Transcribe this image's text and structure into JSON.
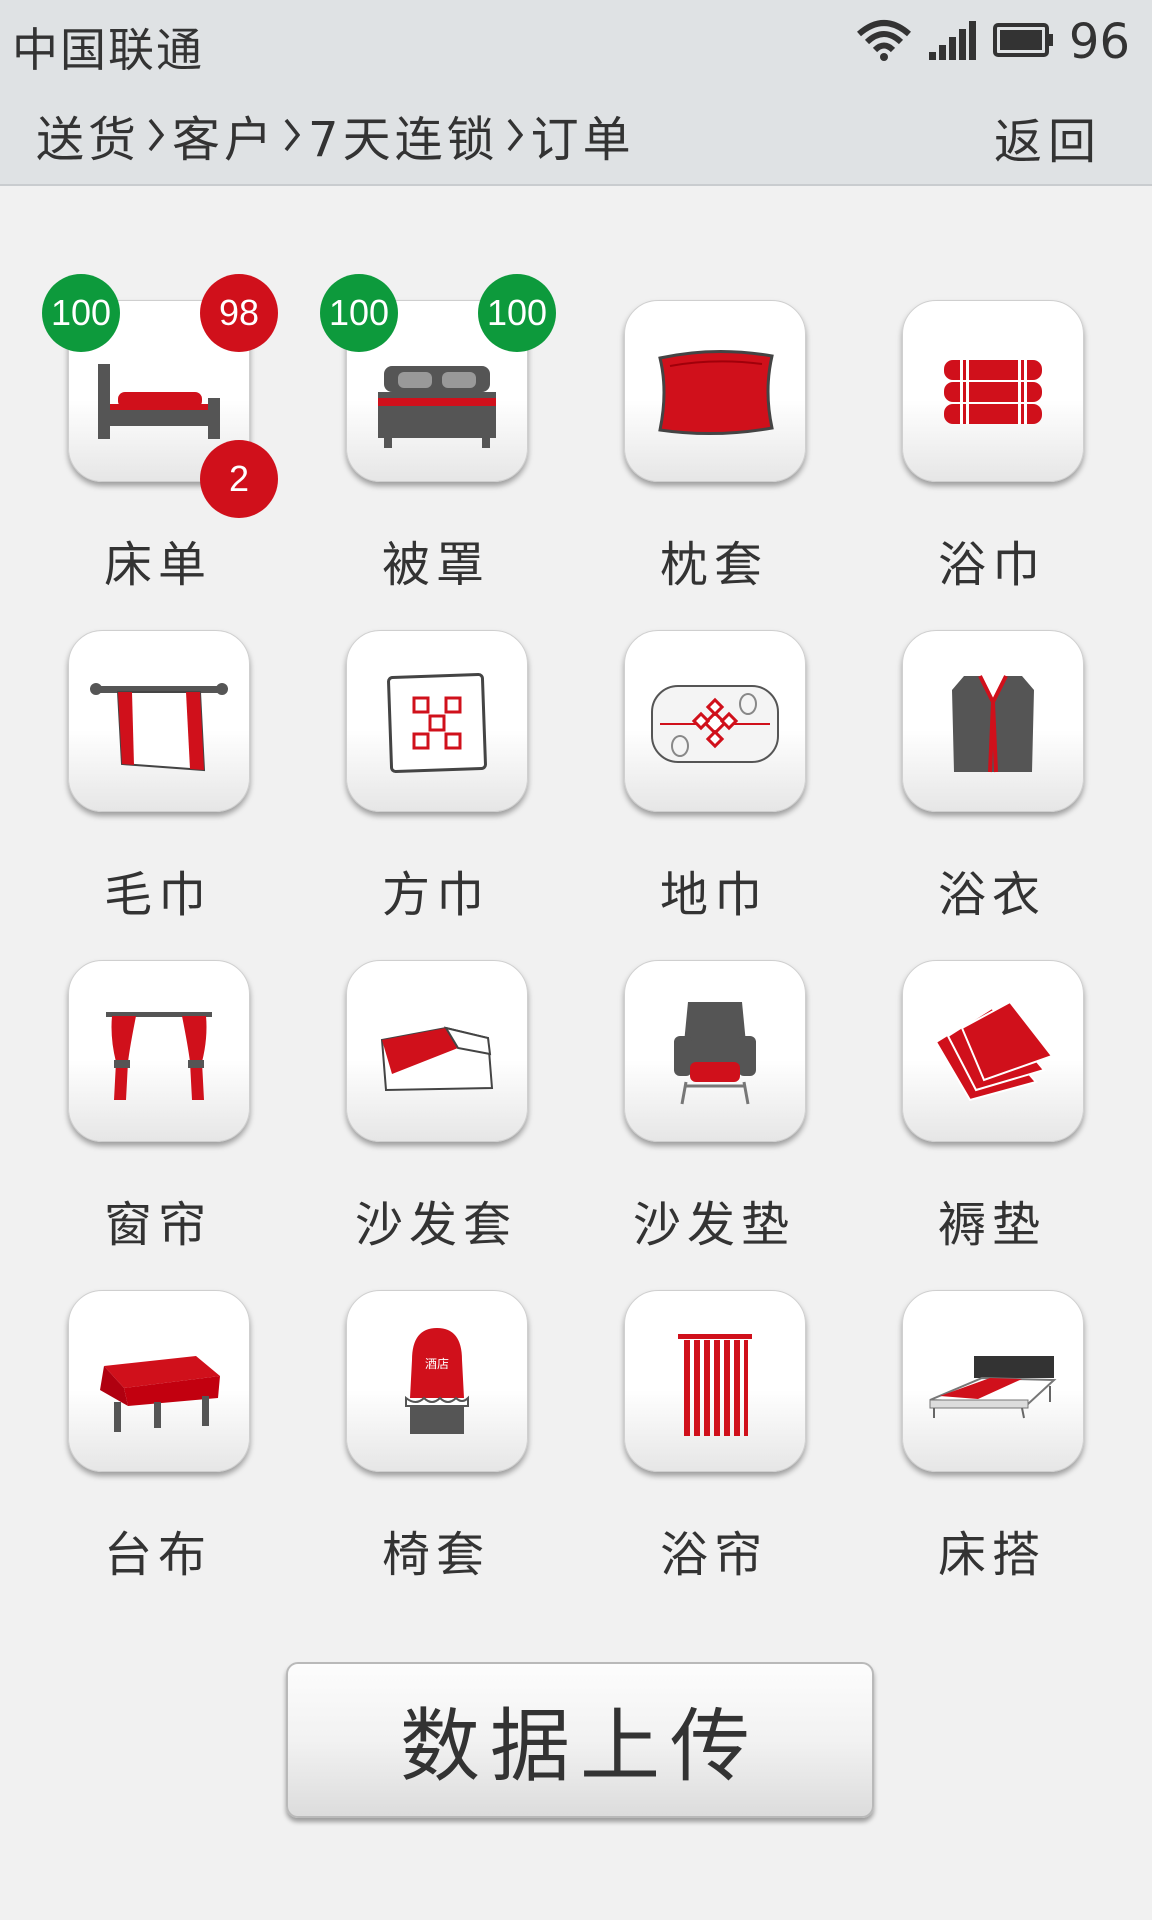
{
  "status_bar": {
    "carrier": "中国联通",
    "battery_percent": "96",
    "icons": [
      "wifi-icon",
      "signal-icon",
      "battery-icon"
    ]
  },
  "nav": {
    "breadcrumb": [
      "送货",
      "客户",
      "7天连锁",
      "订单"
    ],
    "back_label": "返回"
  },
  "items": [
    {
      "label": "床单",
      "icon": "bed-sheet-icon",
      "badges": {
        "top_left": "100",
        "top_right": "98",
        "bottom_right": "2"
      }
    },
    {
      "label": "被罩",
      "icon": "duvet-cover-icon",
      "badges": {
        "top_left": "100",
        "top_right": "100"
      }
    },
    {
      "label": "枕套",
      "icon": "pillowcase-icon"
    },
    {
      "label": "浴巾",
      "icon": "bath-towel-icon"
    },
    {
      "label": "毛巾",
      "icon": "towel-icon"
    },
    {
      "label": "方巾",
      "icon": "square-towel-icon"
    },
    {
      "label": "地巾",
      "icon": "floor-mat-icon"
    },
    {
      "label": "浴衣",
      "icon": "bathrobe-icon"
    },
    {
      "label": "窗帘",
      "icon": "curtain-icon"
    },
    {
      "label": "沙发套",
      "icon": "sofa-cover-icon"
    },
    {
      "label": "沙发垫",
      "icon": "sofa-cushion-icon"
    },
    {
      "label": "褥垫",
      "icon": "mattress-pad-icon"
    },
    {
      "label": "台布",
      "icon": "tablecloth-icon"
    },
    {
      "label": "椅套",
      "icon": "chair-cover-icon",
      "icon_text": "酒店"
    },
    {
      "label": "浴帘",
      "icon": "shower-curtain-icon"
    },
    {
      "label": "床搭",
      "icon": "bed-runner-icon"
    }
  ],
  "upload_button": "数据上传",
  "colors": {
    "accent_red": "#d0101b",
    "badge_green": "#0d9a3c",
    "icon_gray": "#555555",
    "header_bg": "#dfe2e4"
  }
}
